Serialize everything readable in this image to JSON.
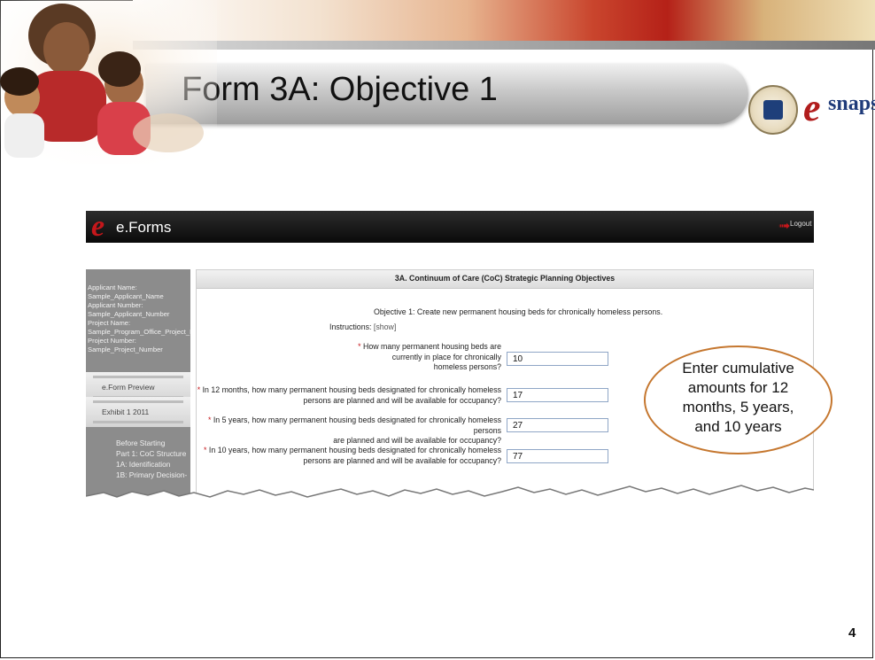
{
  "slide": {
    "title": "Form 3A:  Objective 1",
    "page_number": "4",
    "callout_lines": [
      "Enter cumulative",
      "amounts for 12",
      "months, 5 years,",
      "and 10 years"
    ]
  },
  "logos": {
    "esnaps_e": "e",
    "esnaps_word": "snaps",
    "hud_seal_text": "U.S. DEPARTMENT OF HOUSING AND URBAN DEVELOPMENT"
  },
  "eforms": {
    "app_title": "e.Forms",
    "logout_label": "Logout",
    "sidebar_info": [
      "Applicant Name:",
      "Sample_Applicant_Name",
      "Applicant Number:",
      "Sample_Applicant_Number",
      "Project Name:",
      "Sample_Program_Office_Project_Name",
      "Project Number:",
      "Sample_Project_Number"
    ],
    "sidebar_tabs": [
      "e.Form Preview",
      "Exhibit 1 2011"
    ],
    "sidebar_nav": [
      "Before Starting",
      "Part 1: CoC Structure",
      "1A: Identification",
      "1B: Primary Decision-"
    ],
    "section_title": "3A. Continuum of Care (CoC) Strategic Planning Objectives",
    "objective": "Objective 1: Create new permanent housing beds for chronically homeless persons.",
    "instructions_label": "Instructions:",
    "instructions_link": "[show]",
    "questions": [
      {
        "lines": [
          "How many permanent housing beds are",
          "currently in place for chronically",
          "homeless persons?"
        ],
        "value": "10"
      },
      {
        "lines": [
          "In 12 months, how many permanent housing beds designated for chronically homeless",
          "persons are planned and will be available for occupancy?"
        ],
        "value": "17"
      },
      {
        "lines": [
          "In 5 years, how many permanent housing beds designated for chronically homeless persons",
          "are planned and will be available for occupancy?"
        ],
        "value": "27"
      },
      {
        "lines": [
          "In 10 years, how many permanent housing beds designated for chronically homeless",
          "persons are planned and will be available for occupancy?"
        ],
        "value": "77"
      }
    ]
  },
  "colors": {
    "accent_red": "#c5171b",
    "callout_border": "#c5772f"
  }
}
